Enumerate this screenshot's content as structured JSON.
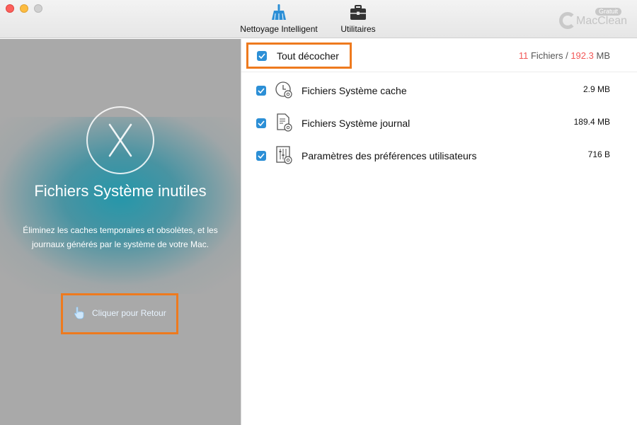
{
  "window": {
    "controls": [
      "close",
      "minimize",
      "maximize"
    ]
  },
  "toolbar": {
    "smart_clean_label": "Nettoyage Intelligent",
    "smart_clean_icon": "broom-icon",
    "utilities_label": "Utilitaires",
    "utilities_icon": "toolbox-icon"
  },
  "brand": {
    "name": "MacClean",
    "badge": "Gratuit"
  },
  "left_panel": {
    "logo_icon": "os-x-logo-icon",
    "title": "Fichiers Système inutiles",
    "description": "Éliminez les caches temporaires et obsolètes, et les journaux générés par le système de votre Mac.",
    "back_label": "Cliquer pour Retour",
    "back_icon": "pointing-hand-icon"
  },
  "right_panel": {
    "select_all": {
      "label": "Tout décocher",
      "checked": true
    },
    "summary": {
      "count": "11",
      "count_label": " Fichiers / ",
      "size": "192.3",
      "size_unit": " MB"
    },
    "items": [
      {
        "label": "Fichiers Système cache",
        "size": "2.9 MB",
        "checked": true,
        "icon": "clock-gear-icon"
      },
      {
        "label": "Fichiers Système journal",
        "size": "189.4 MB",
        "checked": true,
        "icon": "document-gear-icon"
      },
      {
        "label": "Paramètres des préférences utilisateurs",
        "size": "716 B",
        "checked": true,
        "icon": "sliders-gear-icon"
      }
    ]
  },
  "colors": {
    "accent_blue": "#2c8fd6",
    "highlight_orange": "#ee7a1e",
    "summary_red": "#f25757",
    "left_bg": "#a9a9a9",
    "glow_teal": "#1e96aa"
  }
}
